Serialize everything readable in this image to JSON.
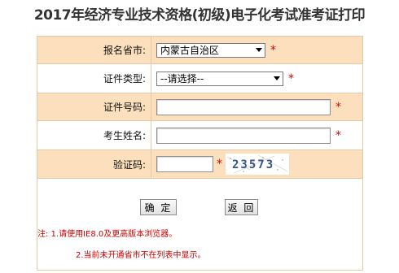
{
  "page_title": "2017年经济专业技术资格(初级)电子化考试准考证打印",
  "form": {
    "province_label": "报名省市:",
    "province_value": "内蒙古自治区",
    "idtype_label": "证件类型:",
    "idtype_value": "--请选择--",
    "idnum_label": "证件号码:",
    "idnum_value": "",
    "name_label": "考生姓名:",
    "name_value": "",
    "captcha_label": "验证码:",
    "captcha_value": "",
    "captcha_text": "23573",
    "required_mark": "*"
  },
  "buttons": {
    "confirm": "确 定",
    "back": "返 回"
  },
  "notes": {
    "note1": "注: 1.请使用IE8.0及更高版本浏览器。",
    "note2": "2.当前未开通省市不在列表中显示。"
  },
  "colors": {
    "shaded_row": "#fce0bd",
    "border": "#e2c9a8",
    "required": "#e00000",
    "note_text": "#cc0000"
  }
}
